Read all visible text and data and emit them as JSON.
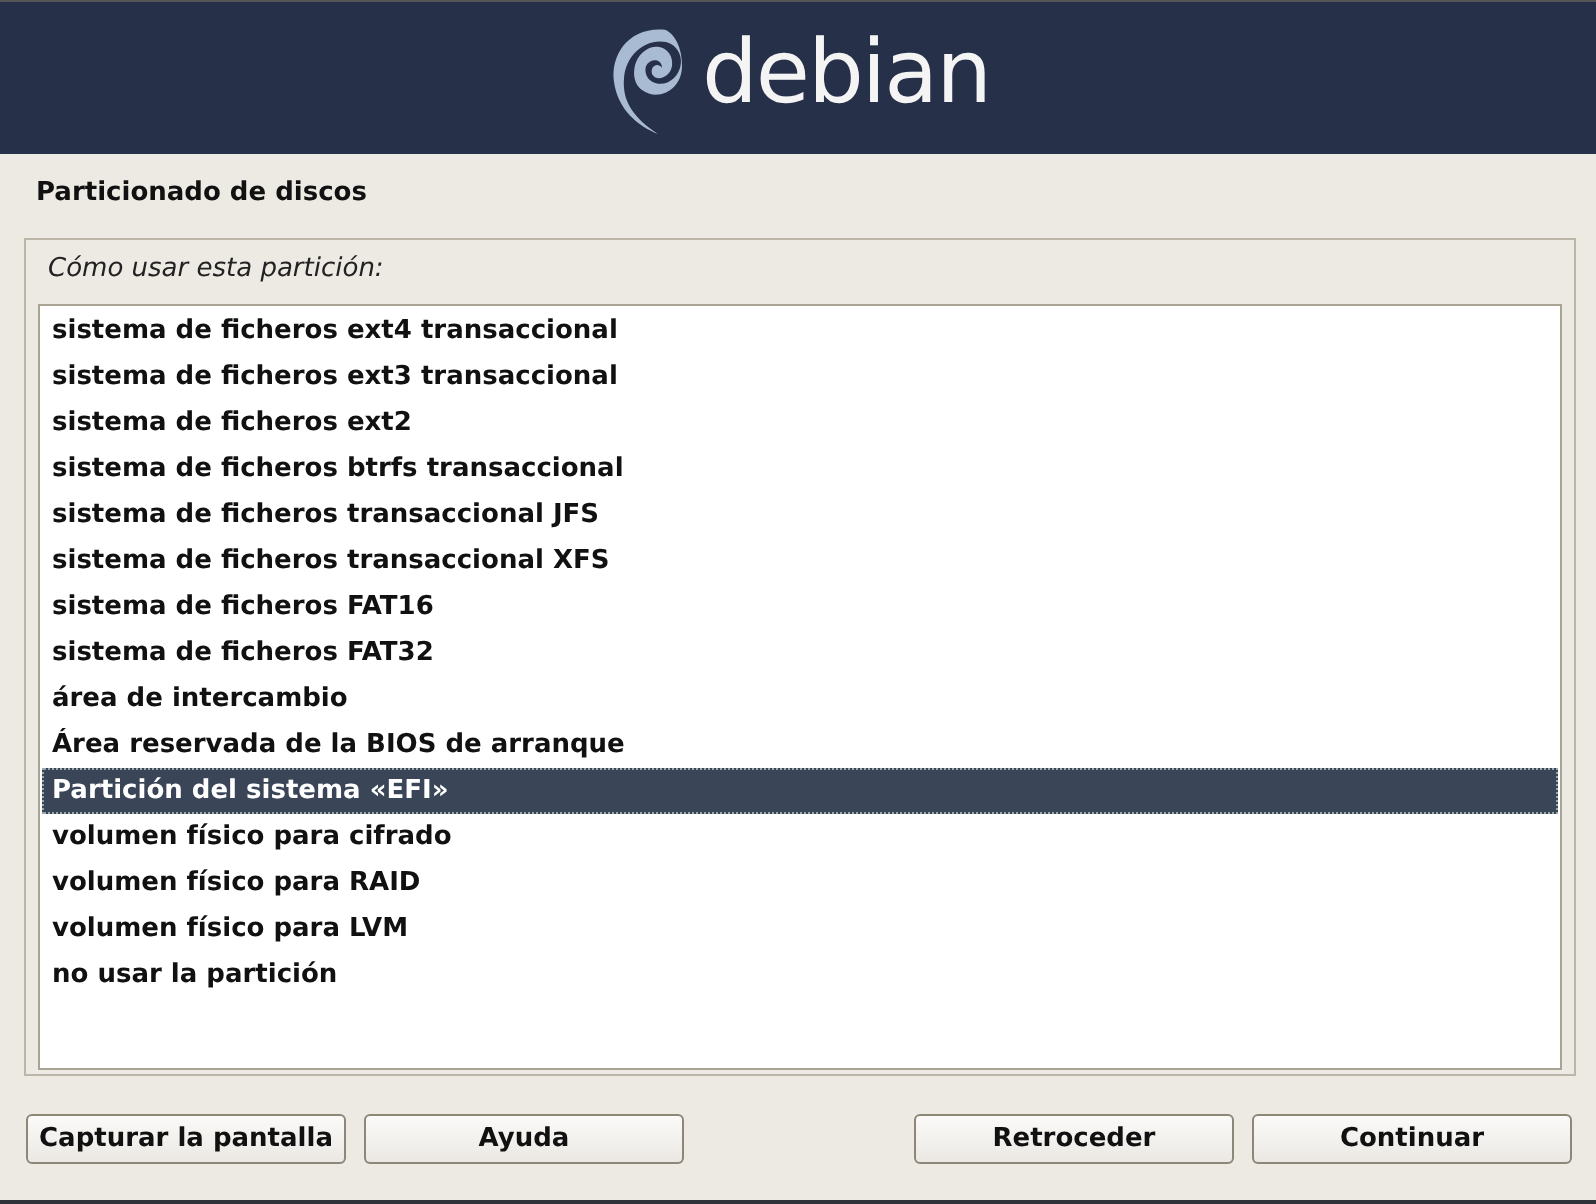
{
  "banner": {
    "logo_text": "debian"
  },
  "title": "Particionado de discos",
  "prompt": "Cómo usar esta partición:",
  "options": [
    {
      "label": "sistema de ficheros ext4 transaccional",
      "selected": false
    },
    {
      "label": "sistema de ficheros ext3 transaccional",
      "selected": false
    },
    {
      "label": "sistema de ficheros ext2",
      "selected": false
    },
    {
      "label": "sistema de ficheros btrfs transaccional",
      "selected": false
    },
    {
      "label": "sistema de ficheros transaccional JFS",
      "selected": false
    },
    {
      "label": "sistema de ficheros transaccional XFS",
      "selected": false
    },
    {
      "label": "sistema de ficheros FAT16",
      "selected": false
    },
    {
      "label": "sistema de ficheros FAT32",
      "selected": false
    },
    {
      "label": "área de intercambio",
      "selected": false
    },
    {
      "label": "Área reservada de la BIOS de arranque",
      "selected": false
    },
    {
      "label": "Partición del sistema «EFI»",
      "selected": true
    },
    {
      "label": "volumen físico para cifrado",
      "selected": false
    },
    {
      "label": "volumen físico para RAID",
      "selected": false
    },
    {
      "label": "volumen físico para LVM",
      "selected": false
    },
    {
      "label": "no usar la partición",
      "selected": false
    }
  ],
  "buttons_left": [
    "Capturar la pantalla",
    "Ayuda"
  ],
  "buttons_right": [
    "Retroceder",
    "Continuar"
  ]
}
